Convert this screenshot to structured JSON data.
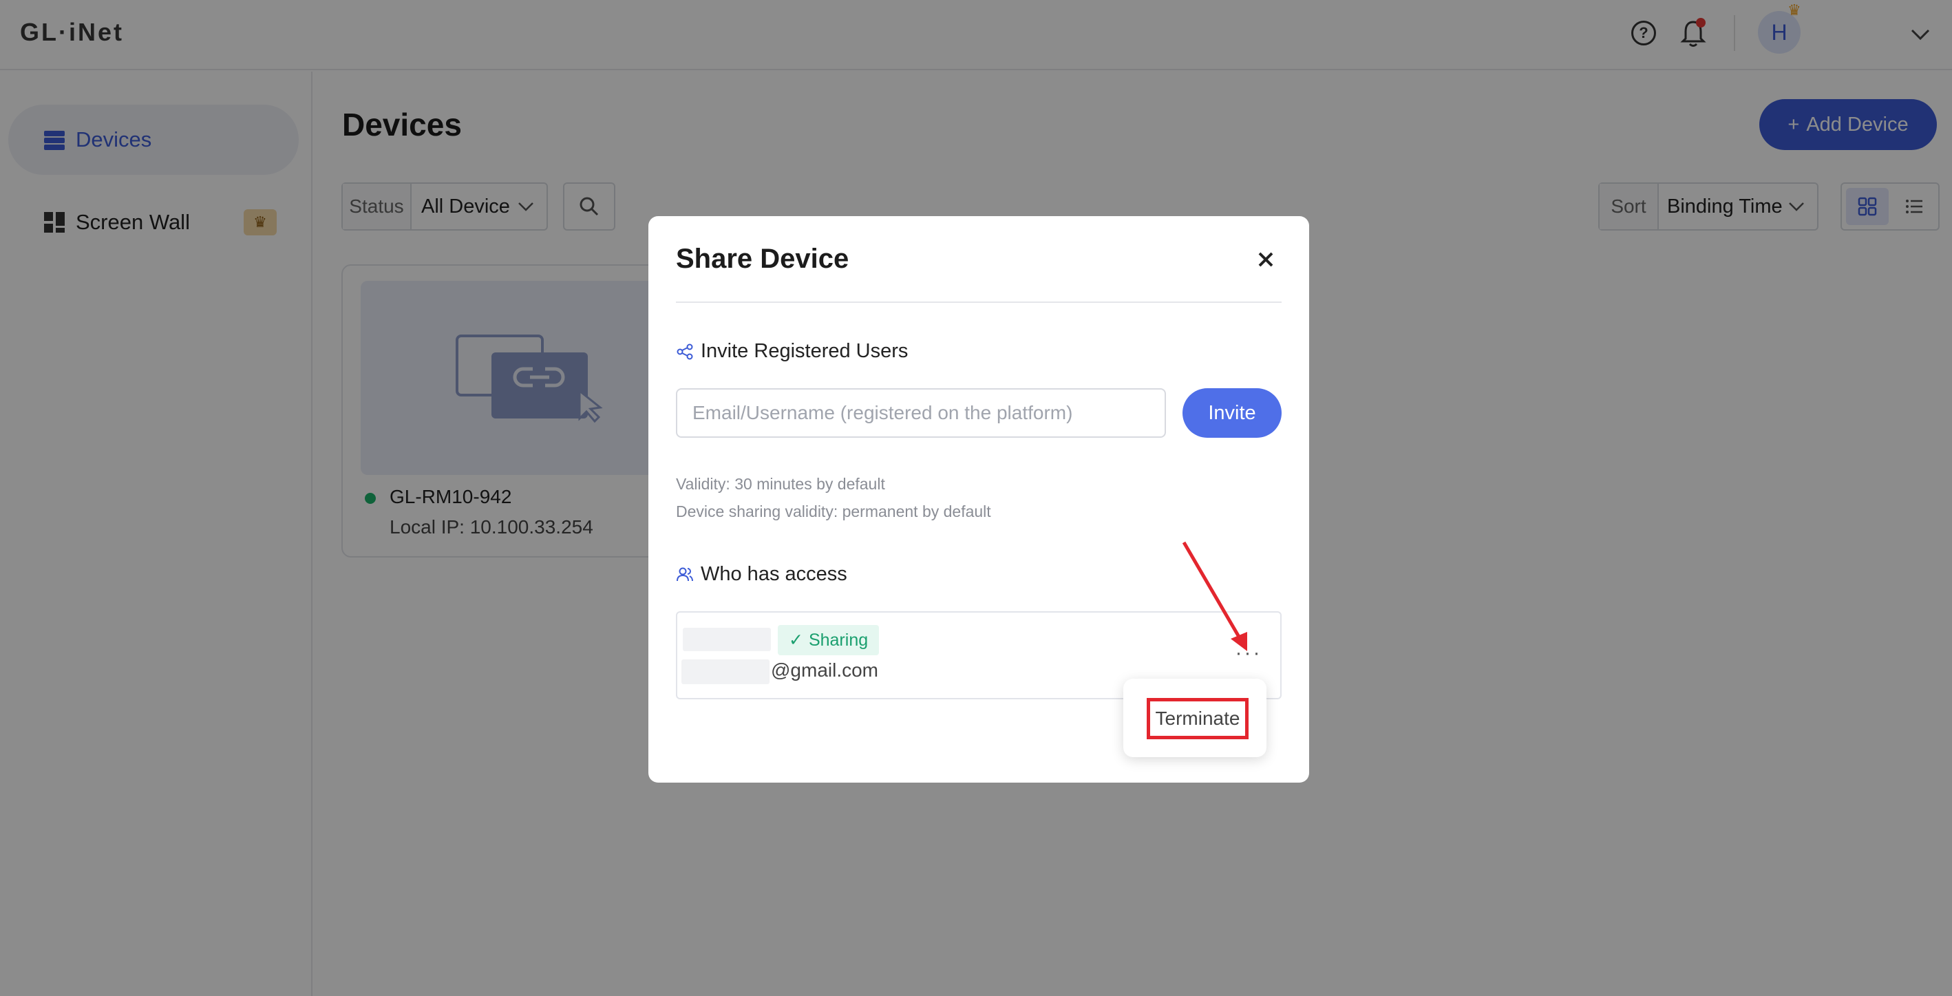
{
  "header": {
    "logo": "GL·iNet",
    "help_icon": "help-circle-icon",
    "bell_icon": "bell-icon",
    "avatar_initial": "H",
    "chevron_icon": "chevron-down-icon",
    "accent_color": "#3c5bd6"
  },
  "sidebar": {
    "items": [
      {
        "label": "Devices",
        "icon": "devices-icon",
        "active": true
      },
      {
        "label": "Screen Wall",
        "icon": "grid-icon",
        "badge": "crown-icon"
      }
    ]
  },
  "main": {
    "title": "Devices",
    "add_button": "Add Device",
    "filter": {
      "label": "Status",
      "value": "All Device"
    },
    "sort": {
      "label": "Sort",
      "value": "Binding Time"
    },
    "views": [
      "grid-view-icon",
      "list-view-icon"
    ],
    "device": {
      "name": "GL-RM10-942",
      "ip": "Local IP: 10.100.33.254",
      "status_color": "#1db36b"
    }
  },
  "modal": {
    "title": "Share Device",
    "invite_section": "Invite Registered Users",
    "email_placeholder": "Email/Username (registered on the platform)",
    "invite_button": "Invite",
    "validity_note": "Validity: 30 minutes by default",
    "sharing_note": "Device sharing validity: permanent by default",
    "access_section": "Who has access",
    "access_entry": {
      "status": "Sharing",
      "email_suffix": "@gmail.com",
      "more": "···"
    },
    "menu": {
      "terminate": "Terminate"
    }
  }
}
